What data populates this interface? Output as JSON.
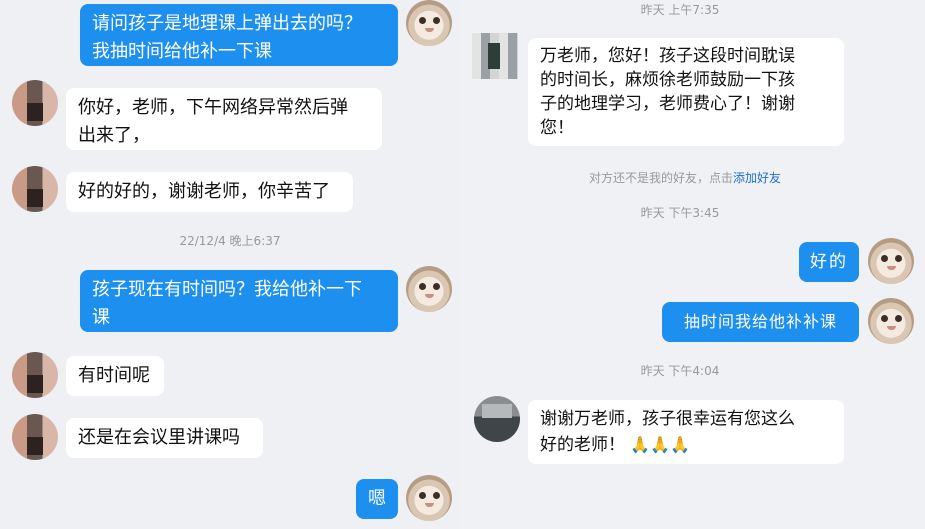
{
  "left_chat": {
    "messages": [
      {
        "id": "m1",
        "side": "out",
        "text_lines": [
          "请问孩子是地理课上弹出去的吗？",
          "我抽时间给他补一下课"
        ]
      },
      {
        "id": "m2",
        "side": "in",
        "text_lines": [
          "你好，老师，下午网络异常然后弹",
          "出来了，"
        ]
      },
      {
        "id": "m3",
        "side": "in",
        "text_lines": [
          "好的好的，谢谢老师，你辛苦了"
        ]
      },
      {
        "id": "t1",
        "type": "time",
        "text": "22/12/4 晚上6:37"
      },
      {
        "id": "m4",
        "side": "out",
        "text_lines": [
          "孩子现在有时间吗？我给他补一下",
          "课"
        ]
      },
      {
        "id": "m5",
        "side": "in",
        "text_lines": [
          "有时间呢"
        ]
      },
      {
        "id": "m6",
        "side": "in",
        "text_lines": [
          "还是在会议里讲课吗"
        ]
      },
      {
        "id": "m7",
        "side": "out",
        "text_lines": [
          "嗯"
        ]
      }
    ]
  },
  "right_chat": {
    "messages": [
      {
        "id": "r_t0",
        "type": "time",
        "text": "昨天 上午7:35"
      },
      {
        "id": "r1",
        "side": "in",
        "text_lines": [
          "万老师，您好！孩子这段时间耽误",
          "的时间长，麻烦徐老师鼓励一下孩",
          "子的地理学习，老师费心了！谢谢",
          "您！"
        ]
      },
      {
        "id": "r_notice",
        "type": "notice",
        "text": "对方还不是我的好友，点击",
        "link": "添加好友"
      },
      {
        "id": "r_t1",
        "type": "time",
        "text": "昨天 下午3:45"
      },
      {
        "id": "r2",
        "side": "out",
        "text_lines": [
          "好的"
        ]
      },
      {
        "id": "r3",
        "side": "out",
        "text_lines": [
          "抽时间我给他补补课"
        ]
      },
      {
        "id": "r_t2",
        "type": "time",
        "text": "昨天 下午4:04"
      },
      {
        "id": "r4",
        "side": "in",
        "text_lines": [
          "谢谢万老师，孩子很幸运有您这么",
          "好的老师！"
        ],
        "emoji": "🙏🙏🙏"
      }
    ]
  },
  "icons": {
    "teacher_avatar": "cat-avatar-icon",
    "parent_avatar": "pixelated-avatar-icon"
  },
  "colors": {
    "outgoing_bubble": "#1d8fef",
    "incoming_bubble": "#ffffff",
    "background": "#eef0f4",
    "link": "#1d6fd6"
  }
}
